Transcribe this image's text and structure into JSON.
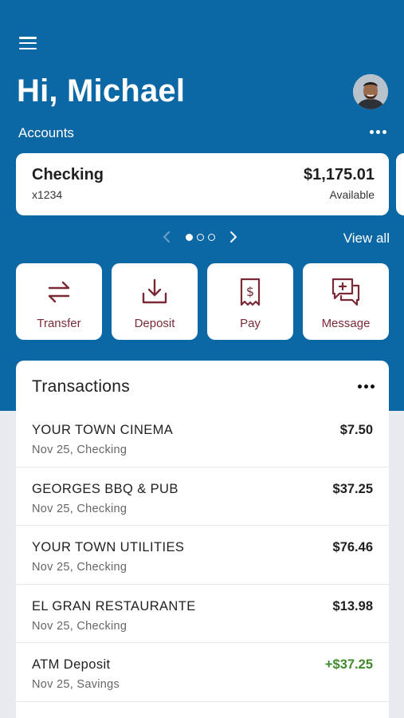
{
  "header": {
    "greeting": "Hi, Michael",
    "menu_icon": "hamburger-menu-icon",
    "avatar_icon": "user-avatar"
  },
  "accounts": {
    "label": "Accounts",
    "view_all": "View all",
    "pager": {
      "current_page": 1,
      "total_pages": 3
    },
    "cards": [
      {
        "name": "Checking",
        "number": "x1234",
        "balance": "$1,175.01",
        "balance_label": "Available"
      }
    ]
  },
  "actions": [
    {
      "label": "Transfer",
      "icon": "transfer-arrows-icon"
    },
    {
      "label": "Deposit",
      "icon": "deposit-tray-icon"
    },
    {
      "label": "Pay",
      "icon": "pay-bill-icon"
    },
    {
      "label": "Message",
      "icon": "message-plus-icon"
    }
  ],
  "transactions": {
    "title": "Transactions",
    "items": [
      {
        "merchant": "YOUR TOWN CINEMA",
        "meta": "Nov 25, Checking",
        "amount": "$7.50",
        "type": "debit"
      },
      {
        "merchant": "GEORGES BBQ & PUB",
        "meta": "Nov 25, Checking",
        "amount": "$37.25",
        "type": "debit"
      },
      {
        "merchant": "YOUR TOWN UTILITIES",
        "meta": "Nov 25, Checking",
        "amount": "$76.46",
        "type": "debit"
      },
      {
        "merchant": "EL GRAN RESTAURANTE",
        "meta": "Nov 25, Checking",
        "amount": "$13.98",
        "type": "debit"
      },
      {
        "merchant": "ATM Deposit",
        "meta": "Nov 25, Savings",
        "amount": "+$37.25",
        "type": "credit"
      }
    ]
  },
  "colors": {
    "brand_blue": "#0c67a5",
    "accent_maroon": "#7a2a36",
    "credit_green": "#3f8a2a",
    "page_background": "#e9eaee"
  }
}
